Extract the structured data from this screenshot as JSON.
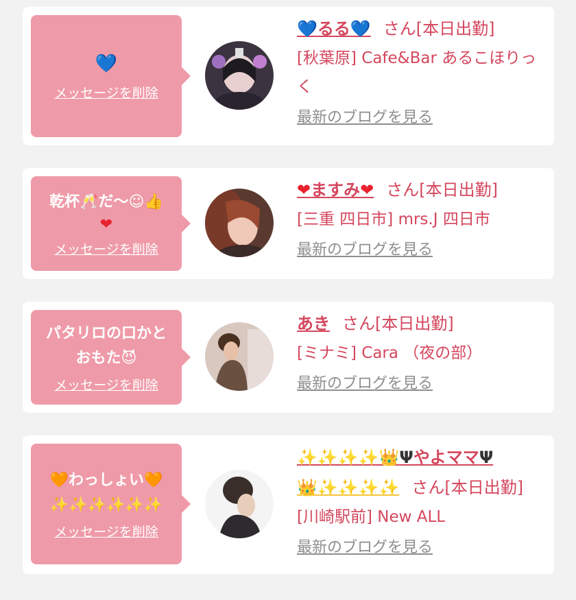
{
  "cards": [
    {
      "bubble": {
        "message": "💙",
        "delete_label": "メッセージを削除"
      },
      "cast": {
        "name_prefix": "💙",
        "name": "るる",
        "name_suffix": "💙",
        "honorific": "さん[本日出勤]",
        "shop": "[秋葉原] Cafe&Bar あるこほりっく",
        "blog_link": "最新のブログを見る"
      }
    },
    {
      "bubble": {
        "message": "乾杯🥂だ〜☺👍",
        "message_line2": "❤",
        "delete_label": "メッセージを削除"
      },
      "cast": {
        "name_prefix": "❤",
        "name": "ますみ",
        "name_suffix": "❤",
        "honorific": "さん[本日出勤]",
        "shop": "[三重 四日市] mrs.J 四日市",
        "blog_link": "最新のブログを見る"
      }
    },
    {
      "bubble": {
        "message": "パタリロの口かと",
        "message_line2": "おもた😈",
        "delete_label": "メッセージを削除"
      },
      "cast": {
        "name": "あき",
        "honorific": "さん[本日出勤]",
        "shop": "[ミナミ] Cara （夜の部）",
        "blog_link": "最新のブログを見る"
      }
    },
    {
      "bubble": {
        "message": "🧡わっしょい🧡",
        "message_line2": "✨✨✨✨✨✨",
        "delete_label": "メッセージを削除"
      },
      "cast": {
        "name_prefix": "✨✨✨✨👑",
        "name_trident": "Ψ",
        "name": "やよママ",
        "name_trident2": "Ψ",
        "name_line2": "👑✨✨✨✨",
        "honorific": "さん[本日出勤]",
        "shop": "[川崎駅前] New ALL",
        "blog_link": "最新のブログを見る"
      }
    }
  ]
}
